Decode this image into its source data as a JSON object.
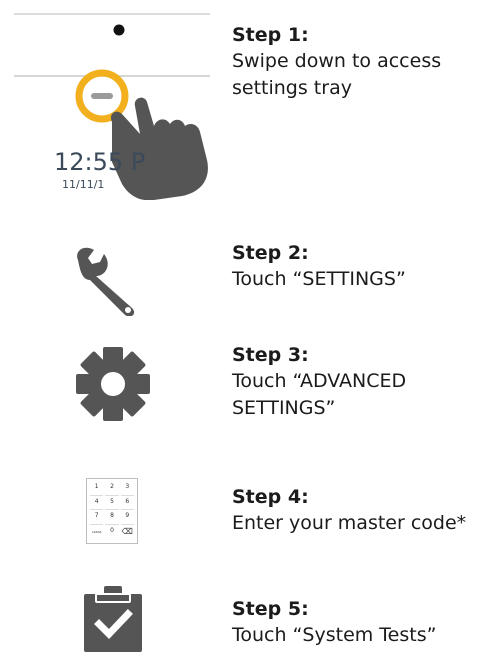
{
  "steps": [
    {
      "title": "Step 1:",
      "lines": [
        "Swipe down to access",
        "settings tray"
      ],
      "icon": "swipe-down-hand-icon"
    },
    {
      "title": "Step 2:",
      "lines": [
        "Touch “SETTINGS”"
      ],
      "icon": "wrench-icon"
    },
    {
      "title": "Step 3:",
      "lines": [
        "Touch “ADVANCED",
        "SETTINGS”"
      ],
      "icon": "gear-icon"
    },
    {
      "title": "Step 4:",
      "lines": [
        "Enter your master code*"
      ],
      "icon": "keypad-icon"
    },
    {
      "title": "Step 5:",
      "lines": [
        "Touch “System Tests”"
      ],
      "icon": "clipboard-check-icon"
    }
  ],
  "screen_preview": {
    "time": "12:55 P",
    "date": "11/11/1"
  },
  "keypad": {
    "keys": [
      "1",
      "2",
      "3",
      "4",
      "5",
      "6",
      "7",
      "8",
      "9",
      "CLEAR",
      "0",
      "⌫"
    ]
  },
  "colors": {
    "text": "#1b1b1b",
    "icon_gray": "#555555",
    "highlight_ring": "#f2b01e",
    "divider": "#c8c8c8"
  }
}
